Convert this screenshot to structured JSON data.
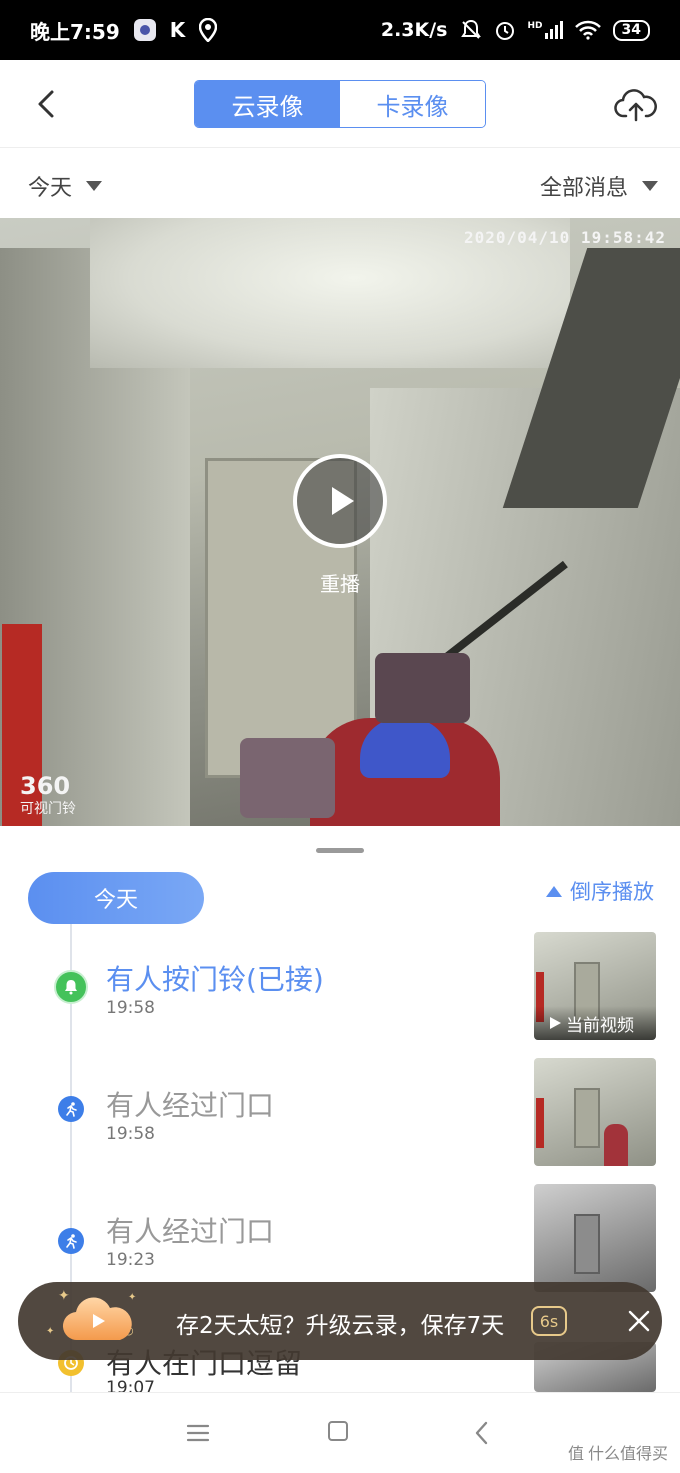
{
  "status_bar": {
    "time": "晚上7:59",
    "k_icon": "K",
    "speed": "2.3K/s",
    "network": "HD",
    "battery": "34"
  },
  "header": {
    "tabs": [
      {
        "label": "云录像",
        "active": true
      },
      {
        "label": "卡录像",
        "active": false
      }
    ],
    "back_icon": "chevron-left-icon",
    "upload_icon": "cloud-upload-icon"
  },
  "filters": {
    "date_filter": "今天",
    "type_filter": "全部消息"
  },
  "video": {
    "timestamp": "2020/04/10 19:58:42",
    "logo_number": "360",
    "logo_text": "可视门铃",
    "replay_label": "重播"
  },
  "timeline": {
    "date_pill": "今天",
    "reverse_label": "倒序播放",
    "events": [
      {
        "title": "有人按门铃(已接)",
        "time": "19:58",
        "icon": "bell-icon",
        "color": "#44c25a",
        "title_color": "#5b8ff0",
        "thumb_caption": "当前视频"
      },
      {
        "title": "有人经过门口",
        "time": "19:58",
        "icon": "running-person-icon",
        "color": "#3d7ee8",
        "title_color": "#999999"
      },
      {
        "title": "有人经过门口",
        "time": "19:23",
        "icon": "running-person-icon",
        "color": "#3d7ee8",
        "title_color": "#999999"
      },
      {
        "title": "有人在门口逗留",
        "time": "19:07",
        "icon": "clock-icon",
        "color": "#f2c02e",
        "title_color": "#333333"
      }
    ]
  },
  "promo": {
    "text": "存2天太短？升级云录，保存7天",
    "countdown": "6s"
  },
  "watermark": "什么值得买",
  "colors": {
    "accent": "#5b8ff0",
    "promo_bg": "#423830",
    "promo_gold": "#e7c98a"
  }
}
